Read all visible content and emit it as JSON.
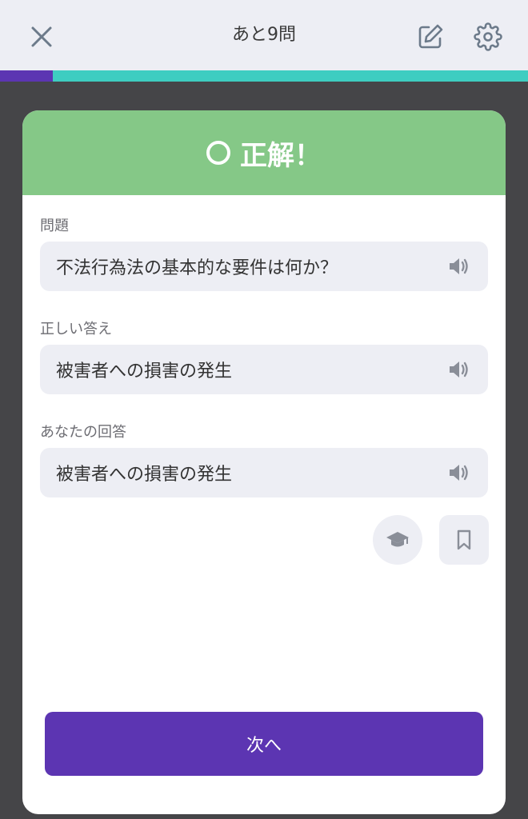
{
  "header": {
    "title": "あと9問"
  },
  "progress": {
    "completed_fraction": 0.1
  },
  "result": {
    "label": "正解！"
  },
  "question": {
    "label": "問題",
    "text": "不法行為法の基本的な要件は何か？"
  },
  "correct_answer": {
    "label": "正しい答え",
    "text": "被害者への損害の発生"
  },
  "your_answer": {
    "label": "あなたの回答",
    "text": "被害者への損害の発生"
  },
  "next_button": {
    "label": "次へ"
  },
  "colors": {
    "accent": "#5c35b2",
    "progress_remaining": "#3ecdc1",
    "correct_header": "#85c887",
    "panel_bg": "#edeef4"
  },
  "icons": [
    "close-icon",
    "edit-icon",
    "settings-icon",
    "circle-icon",
    "speaker-icon",
    "graduation-cap-icon",
    "bookmark-icon"
  ]
}
